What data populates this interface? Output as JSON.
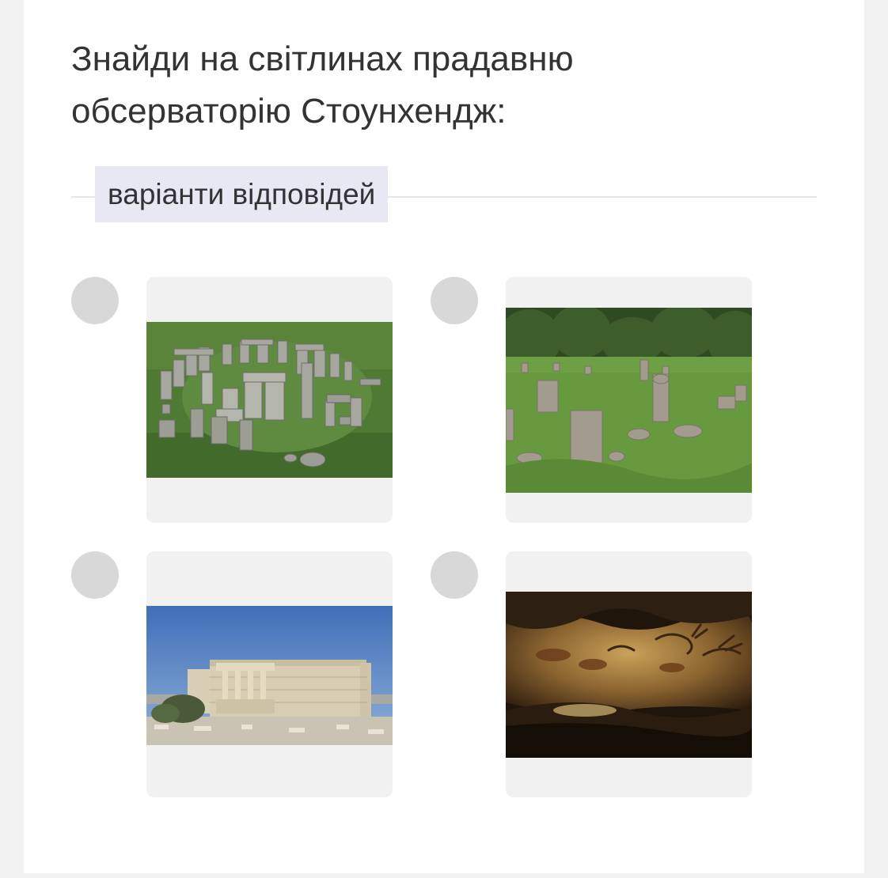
{
  "question": {
    "text": "Знайди на світлинах прадавню\nобсерваторію Стоунхендж:"
  },
  "answers": {
    "label": "варіанти відповідей",
    "options": [
      {
        "image_icon": "stonehenge-photo",
        "selected": false
      },
      {
        "image_icon": "stone-circle-in-meadow-photo",
        "selected": false
      },
      {
        "image_icon": "greek-temple-erechtheion-photo",
        "selected": false
      },
      {
        "image_icon": "cave-paintings-lascaux-photo",
        "selected": false
      }
    ]
  },
  "colors": {
    "radio_unselected": "#d8d8d8",
    "label_background": "#e8e8f5",
    "thumb_background": "#f1f1f1",
    "text": "#333333"
  }
}
